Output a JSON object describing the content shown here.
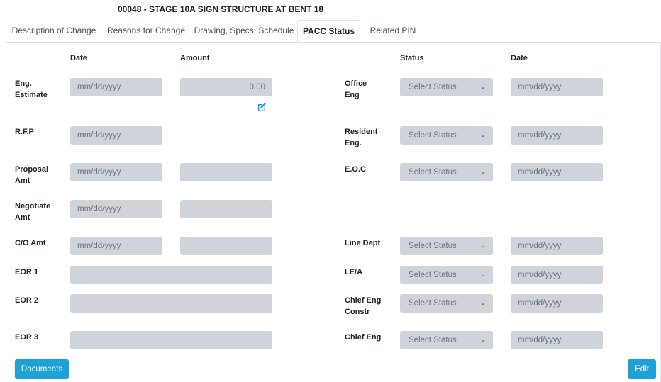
{
  "page": {
    "title": "00048 - STAGE 10A SIGN STRUCTURE AT BENT 18"
  },
  "tabs": [
    {
      "label": "Description of Change"
    },
    {
      "label": "Reasons for Change"
    },
    {
      "label": "Drawing, Specs, Schedule"
    },
    {
      "label": "PACC Status",
      "active": true
    },
    {
      "label": "Related PIN"
    }
  ],
  "headers": {
    "date": "Date",
    "amount": "Amount",
    "status": "Status",
    "date2": "Date"
  },
  "placeholders": {
    "date": "mm/dd/yyyy",
    "status": "Select Status"
  },
  "left_rows": [
    {
      "label": "Eng.\nEstimate",
      "date": "mm/dd/yyyy",
      "amount": "0.00"
    },
    {
      "label": "R.F.P",
      "date": "mm/dd/yyyy"
    },
    {
      "label": "Proposal\nAmt",
      "date": "mm/dd/yyyy",
      "amount": ""
    },
    {
      "label": "Negotiate\nAmt",
      "date": "mm/dd/yyyy",
      "amount": ""
    },
    {
      "label": "C/O Amt",
      "date": "mm/dd/yyyy",
      "amount": ""
    },
    {
      "label": "EOR 1",
      "value": ""
    },
    {
      "label": "EOR 2",
      "value": ""
    },
    {
      "label": "EOR 3",
      "value": ""
    }
  ],
  "right_rows": [
    {
      "label": "Office\nEng",
      "status": "Select Status",
      "date": "mm/dd/yyyy"
    },
    {
      "label": "Resident\nEng.",
      "status": "Select Status",
      "date": "mm/dd/yyyy"
    },
    {
      "label": "E.O.C",
      "status": "Select Status",
      "date": "mm/dd/yyyy"
    },
    {
      "label": "Line Dept",
      "status": "Select Status",
      "date": "mm/dd/yyyy"
    },
    {
      "label": "LE/A",
      "status": "Select Status",
      "date": "mm/dd/yyyy"
    },
    {
      "label": "Chief Eng\nConstr",
      "status": "Select Status",
      "date": "mm/dd/yyyy"
    },
    {
      "label": "Chief Eng",
      "status": "Select Status",
      "date": "mm/dd/yyyy"
    }
  ],
  "icons": {
    "edit": "edit-icon",
    "chevron": "chevron-down-icon"
  },
  "buttons": {
    "documents": "Documents",
    "edit": "Edit"
  },
  "colors": {
    "accent": "#1da1d6",
    "field": "#ced4da"
  }
}
